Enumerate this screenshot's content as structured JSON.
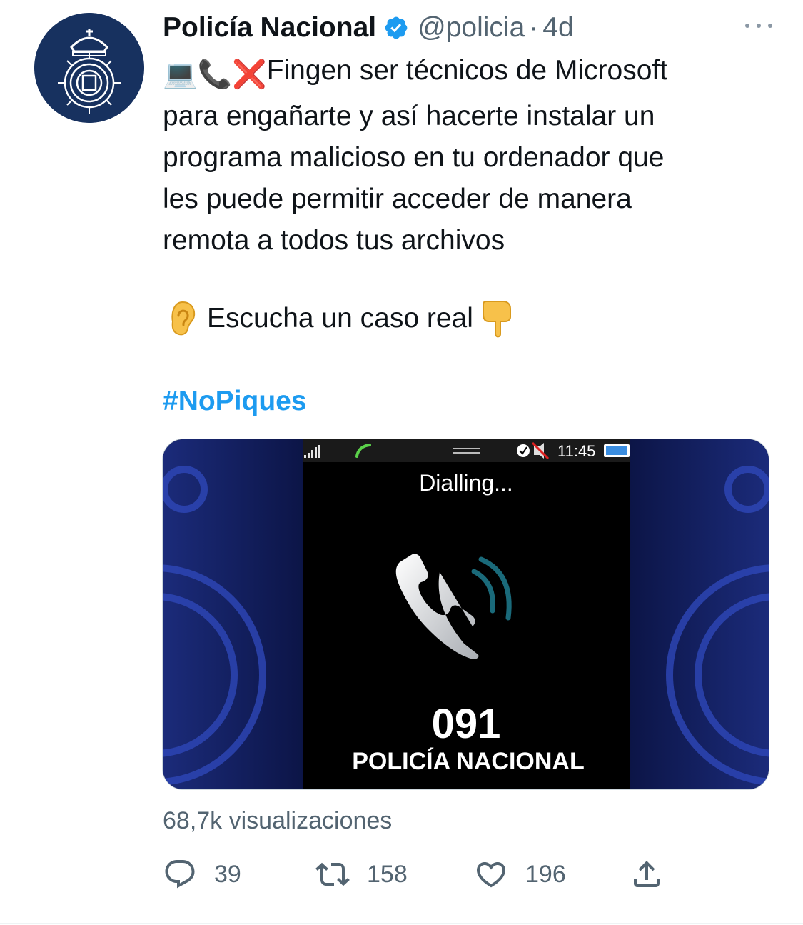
{
  "tweet": {
    "author_name": "Policía Nacional",
    "handle": "@policia",
    "separator": "·",
    "time": "4d",
    "text_emoji_prefix": "💻📞❌",
    "text_lines": [
      "Fingen ser técnicos de Microsoft",
      "para engañarte y así hacerte instalar un",
      "programa malicioso en tu ordenador que",
      "les puede permitir acceder de manera",
      "remota a todos tus archivos"
    ],
    "listen_text": "Escucha un caso real",
    "hashtag": "#NoPiques"
  },
  "media": {
    "status_time": "11:45",
    "dialling": "Dialling...",
    "number": "091",
    "caller": "POLICÍA NACIONAL"
  },
  "stats": {
    "views": "68,7k visualizaciones",
    "replies": "39",
    "retweets": "158",
    "likes": "196"
  },
  "colors": {
    "link": "#1d9bf0",
    "secondary": "#536471",
    "avatar_bg": "#17315f"
  },
  "icons": {
    "verified": "verified-badge-icon",
    "more": "more-icon",
    "reply": "reply-icon",
    "retweet": "retweet-icon",
    "like": "heart-icon",
    "share": "share-icon"
  }
}
